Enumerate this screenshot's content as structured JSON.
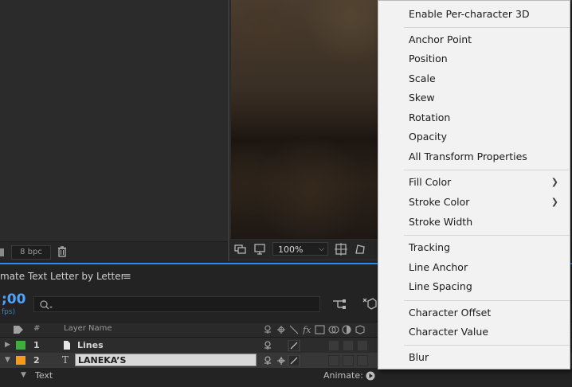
{
  "left_panel": {
    "bpc_label": "8 bpc"
  },
  "viewer": {
    "zoom": "100%"
  },
  "timeline": {
    "tab_title": "mate Text Letter by Letter",
    "menu_glyph": "≡",
    "timecode": ";00",
    "fps_label": "fps)",
    "columns": {
      "number": "#",
      "layer_name": "Layer Name"
    },
    "layers": [
      {
        "number": "1",
        "name": "Lines",
        "label_color": "#3fad3f",
        "type_icon": "document-icon"
      },
      {
        "number": "2",
        "name": "LANEKA’S",
        "label_color": "#f29b1f",
        "type_icon": "T"
      }
    ],
    "sub_row": {
      "name": "Text",
      "animate_label": "Animate:"
    }
  },
  "menu": {
    "items": [
      {
        "label": "Enable Per-character 3D"
      },
      {
        "label": "Anchor Point"
      },
      {
        "label": "Position"
      },
      {
        "label": "Scale"
      },
      {
        "label": "Skew"
      },
      {
        "label": "Rotation"
      },
      {
        "label": "Opacity"
      },
      {
        "label": "All Transform Properties"
      },
      {
        "label": "Fill Color",
        "submenu": true
      },
      {
        "label": "Stroke Color",
        "submenu": true
      },
      {
        "label": "Stroke Width"
      },
      {
        "label": "Tracking"
      },
      {
        "label": "Line Anchor"
      },
      {
        "label": "Line Spacing"
      },
      {
        "label": "Character Offset"
      },
      {
        "label": "Character Value"
      },
      {
        "label": "Blur"
      }
    ]
  },
  "colors": {
    "accent": "#2d8ceb",
    "timecode": "#4fa3ff"
  }
}
